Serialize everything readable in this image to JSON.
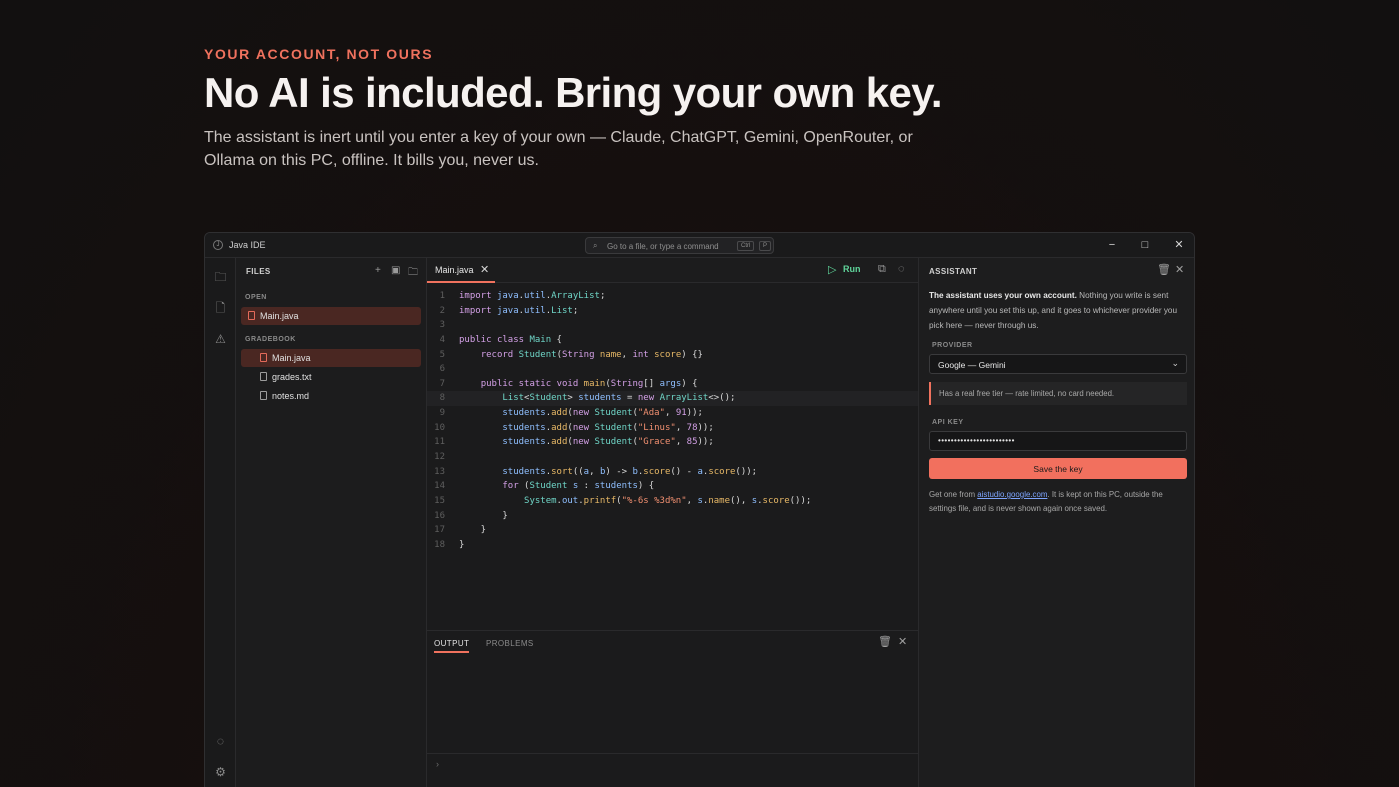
{
  "hero": {
    "eyebrow": "YOUR ACCOUNT, NOT OURS",
    "headline": "No AI is included. Bring your own key.",
    "subline": "The assistant is inert until you enter a key of your own — Claude, ChatGPT, Gemini, OpenRouter, or Ollama on this PC, offline. It bills you, never us."
  },
  "window": {
    "app_logo": "J",
    "title": "Java IDE",
    "command_placeholder": "Go to a file, or type a command",
    "shortcut_ctrl": "Ctrl",
    "shortcut_key": "P",
    "minimize": "−",
    "maximize": "□",
    "close": "✕"
  },
  "files": {
    "header": "FILES",
    "open_section": "OPEN",
    "open_files": [
      "Main.java"
    ],
    "project_section": "GRADEBOOK",
    "project_files": [
      "Main.java",
      "grades.txt",
      "notes.md"
    ]
  },
  "editor": {
    "tab_label": "Main.java",
    "run_label": "Run",
    "lines": [
      "import java.util.ArrayList;",
      "import java.util.List;",
      "",
      "public class Main {",
      "    record Student(String name, int score) {}",
      "",
      "    public static void main(String[] args) {",
      "        List<Student> students = new ArrayList<>();",
      "        students.add(new Student(\"Ada\", 91));",
      "        students.add(new Student(\"Linus\", 78));",
      "        students.add(new Student(\"Grace\", 85));",
      "",
      "        students.sort((a, b) -> b.score() - a.score());",
      "        for (Student s : students) {",
      "            System.out.printf(\"%-6s %3d%n\", s.name(), s.score());",
      "        }",
      "    }",
      "}"
    ],
    "highlighted_line": 8
  },
  "output": {
    "tab_output": "OUTPUT",
    "tab_problems": "PROBLEMS",
    "prompt": "›"
  },
  "assistant": {
    "header": "ASSISTANT",
    "intro_bold": "The assistant uses your own account.",
    "intro_rest": " Nothing you write is sent anywhere until you set this up, and it goes to whichever provider you pick here — never through us.",
    "provider_label": "PROVIDER",
    "provider_value": "Google — Gemini",
    "provider_note": "Has a real free tier — rate limited, no card needed.",
    "api_key_label": "API KEY",
    "api_key_value": "••••••••••••••••••••••••",
    "save_label": "Save the key",
    "help_prefix": "Get one from ",
    "help_link": "aistudio.google.com",
    "help_suffix": ". It is kept on this PC, outside the settings file, and is never shown again once saved."
  },
  "colors": {
    "accent": "#f0725e",
    "run": "#5fd49a",
    "background": "#121010"
  }
}
